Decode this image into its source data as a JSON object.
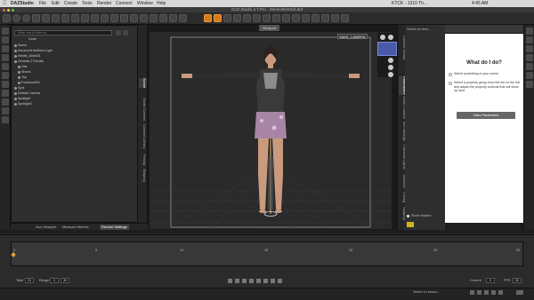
{
  "menubar": {
    "app": "DAZStudio",
    "items": [
      "File",
      "Edit",
      "Create",
      "Tools",
      "Render",
      "Connect",
      "Window",
      "Help"
    ],
    "right": "KTCK - 1310 Th...",
    "time": "4:45 AM"
  },
  "window": {
    "title": "DAZ Studio 4.7 Pro - Zenon/GenGirl.duf"
  },
  "scene": {
    "search_placeholder": "Enter text to filter by...",
    "header": "Node",
    "rows": [
      "Scene",
      "Advanced Ambient Light",
      "Infinite_Disk001",
      "Genesis 2 Female",
      "Hair",
      "Shorts",
      "Top",
      "Footwear001",
      "Spot",
      "Default Camera",
      "Spotlight",
      "Spotlight2"
    ]
  },
  "left_vtabs": [
    "Scene",
    "Smart Content",
    "Content Library",
    "Posing",
    "Shaping"
  ],
  "left_tabs": {
    "aux": "Aux Viewport",
    "metrics": "Measure Metrics",
    "render": "Render Settings"
  },
  "viewport": {
    "tab": "Viewport",
    "camera": "MAIN_CAMERA"
  },
  "right_vtabs": [
    "Parameters",
    "Content Library",
    "Smart Content",
    "Lights",
    "Surfaces",
    "Tool Settings",
    "Cameras",
    "Shaping",
    "Posing",
    "Surfaces2"
  ],
  "rpane": {
    "select_label": "Select an item...",
    "show_hidden": "Show Hidden"
  },
  "help": {
    "title": "What do I do?",
    "step1": "Select something in your scene.",
    "step2": "Select a property group from the list on the left and adjust the property controls that will show up here.",
    "button": "Video Parameters"
  },
  "timeline": {
    "tabs": [
      "Timeline",
      "aniMate2",
      "aniMate2 Constraints"
    ],
    "ticks": [
      "0",
      "5",
      "10",
      "15",
      "20",
      "25",
      "30"
    ],
    "fps_label": "FPS",
    "fps_value": "30",
    "range_label": "Range",
    "range_start": "0",
    "range_end": "30",
    "total_label": "Total",
    "total_value": "31",
    "current_label": "Current",
    "current_value": "0"
  },
  "status": {
    "lesson": "Select a Lesson..."
  }
}
